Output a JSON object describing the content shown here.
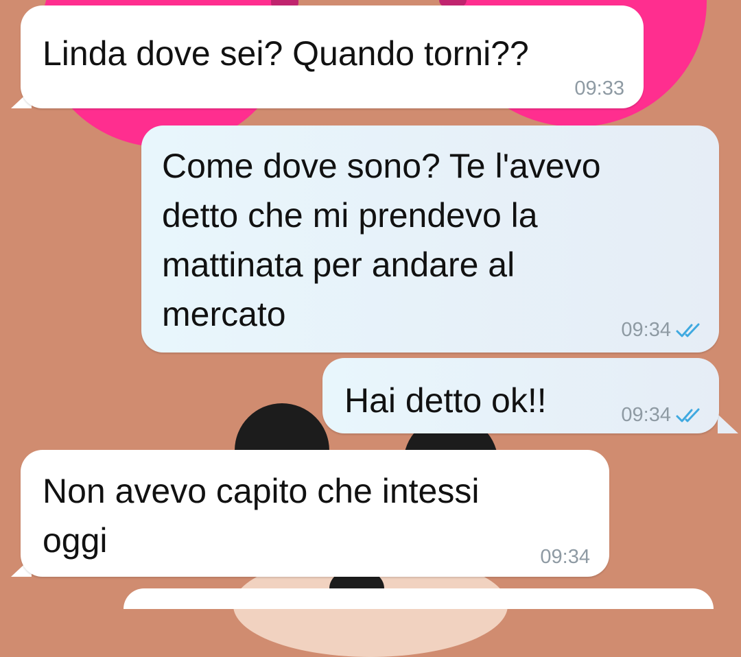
{
  "messages": [
    {
      "direction": "incoming",
      "text": "Linda dove sei? Quando torni??",
      "time": "09:33"
    },
    {
      "direction": "outgoing",
      "text": "Come dove sono? Te l'avevo\ndetto che mi prendevo la\nmattinata per andare al\nmercato",
      "time": "09:34",
      "status": "read"
    },
    {
      "direction": "outgoing",
      "text": "Hai detto ok!!",
      "time": "09:34",
      "status": "read"
    },
    {
      "direction": "incoming",
      "text": "Non avevo capito che intessi\noggi",
      "time": "09:34"
    }
  ],
  "colors": {
    "wallpaper": "#d08c70",
    "incoming_bubble": "#ffffff",
    "outgoing_bubble": "#e8f6fc",
    "read_tick": "#3fa9e0",
    "timestamp": "#8e9aa3"
  },
  "icons": {
    "read_receipt": "double-check-icon"
  }
}
